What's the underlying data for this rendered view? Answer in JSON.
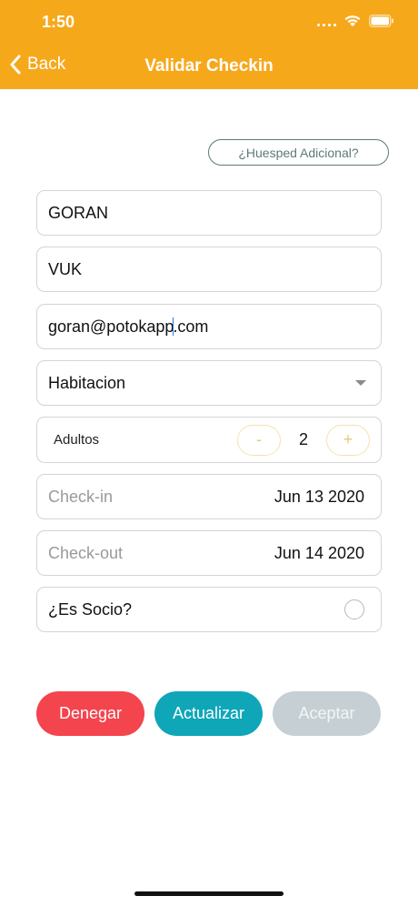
{
  "status": {
    "time": "1:50"
  },
  "nav": {
    "back_label": "Back",
    "title": "Validar Checkin"
  },
  "extra_guest_label": "¿Huesped Adicional?",
  "form": {
    "first_name": "GORAN",
    "last_name": "VUK",
    "email_before_cursor": "goran@potokapp",
    "email_after_cursor": ".com",
    "room_placeholder": "Habitacion",
    "adults_label": "Adultos",
    "minus_label": "-",
    "adults_value": "2",
    "plus_label": "+",
    "checkin_label": "Check-in",
    "checkin_value": "Jun 13 2020",
    "checkout_label": "Check-out",
    "checkout_value": "Jun 14 2020",
    "member_label": "¿Es Socio?"
  },
  "buttons": {
    "deny": "Denegar",
    "update": "Actualizar",
    "accept": "Aceptar"
  },
  "colors": {
    "header": "#f6a81b",
    "deny": "#f4444d",
    "update": "#0fa6b8",
    "accept_disabled": "#c6d0d4"
  }
}
